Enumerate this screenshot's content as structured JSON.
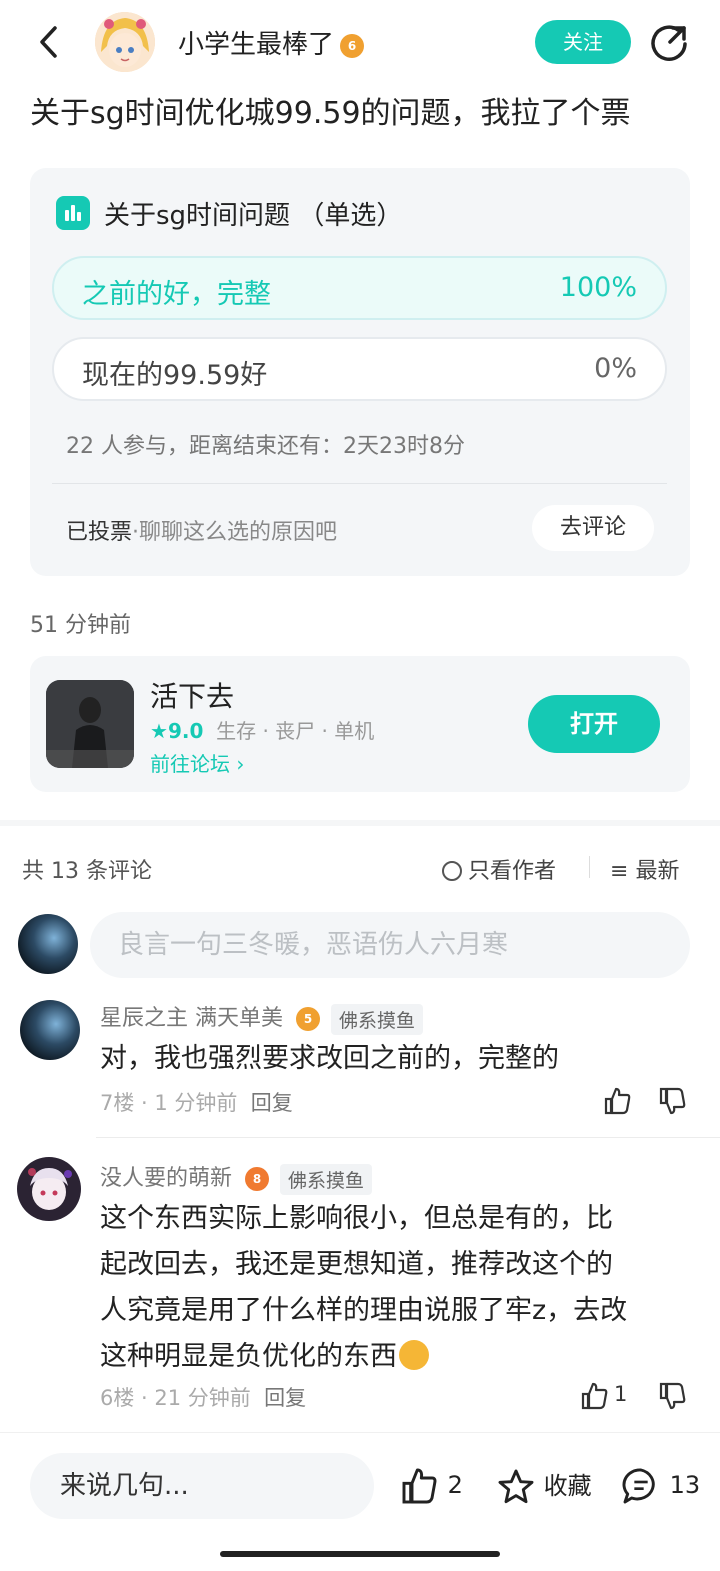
{
  "header": {
    "username": "小学生最棒了",
    "level": "6",
    "follow_label": "关注"
  },
  "post": {
    "title": "关于sg时间优化城99.59的问题，我拉了个票",
    "time_ago": "51 分钟前"
  },
  "poll": {
    "title": "关于sg时间问题 （单选）",
    "options": [
      {
        "label": "之前的好，完整",
        "percent": "100%",
        "selected": true
      },
      {
        "label": "现在的99.59好",
        "percent": "0%",
        "selected": false
      }
    ],
    "meta": "22 人参与，距离结束还有：2天23时8分",
    "voted_label": "已投票",
    "voted_hint": "·聊聊这么选的原因吧",
    "comment_button": "去评论"
  },
  "game": {
    "name": "活下去",
    "rating": "9.0",
    "tags": "生存 · 丧尸 · 单机",
    "forum_link": "前往论坛",
    "open_button": "打开"
  },
  "comments_header": {
    "count": "共 13 条评论",
    "author_only": "只看作者",
    "sort": "最新"
  },
  "comment_input": {
    "placeholder": "良言一句三冬暖，恶语伤人六月寒"
  },
  "comments": [
    {
      "name": "星辰之主 满天单美",
      "level": "5",
      "badge": "佛系摸鱼",
      "text": "对，我也强烈要求改回之前的，完整的",
      "floor": "7楼 · 1 分钟前",
      "reply": "回复",
      "likes": ""
    },
    {
      "name": "没人要的萌新",
      "level": "8",
      "badge": "佛系摸鱼",
      "text_lines": [
        "这个东西实际上影响很小，但总是有的，比",
        "起改回去，我还是更想知道，推荐改这个的",
        "人究竟是用了什么样的理由说服了牢z，去改",
        "这种明显是负优化的东西"
      ],
      "floor": "6楼 · 21 分钟前",
      "reply": "回复",
      "likes": "1"
    }
  ],
  "bottom_bar": {
    "input_label": "来说几句...",
    "likes": "2",
    "favorite": "收藏",
    "comments": "13"
  },
  "colors": {
    "accent": "#15c9b4",
    "card_bg": "#f4f6f8"
  }
}
